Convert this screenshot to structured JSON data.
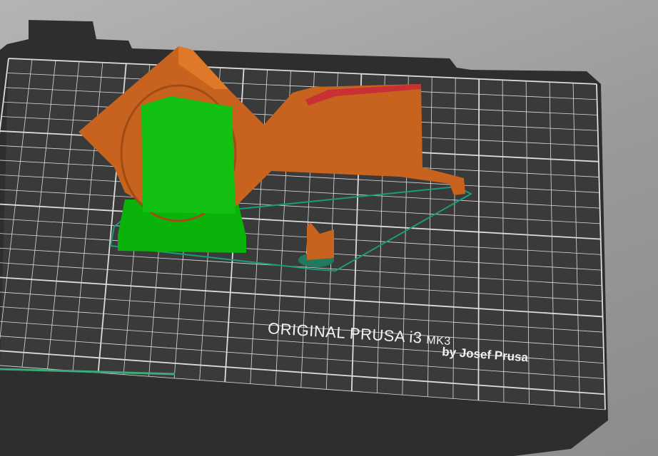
{
  "viewport": {
    "title": "3D print preview",
    "bed_logo": {
      "line1": "ORIGINAL PRUSA i3",
      "model": "MK3",
      "line2": "by Josef Prusa"
    },
    "colors": {
      "background": "#a0a0a0",
      "bed": "#333333",
      "grid": "#e8e8e8",
      "perimeter": "#e06a1e",
      "support": "#00c000",
      "skirt": "#1a8c6e",
      "overhang": "#d02030"
    },
    "objects": [
      {
        "name": "fan-shroud",
        "feature": "perimeter"
      },
      {
        "name": "support-material",
        "feature": "support"
      },
      {
        "name": "small-cylinder",
        "feature": "perimeter"
      }
    ]
  }
}
